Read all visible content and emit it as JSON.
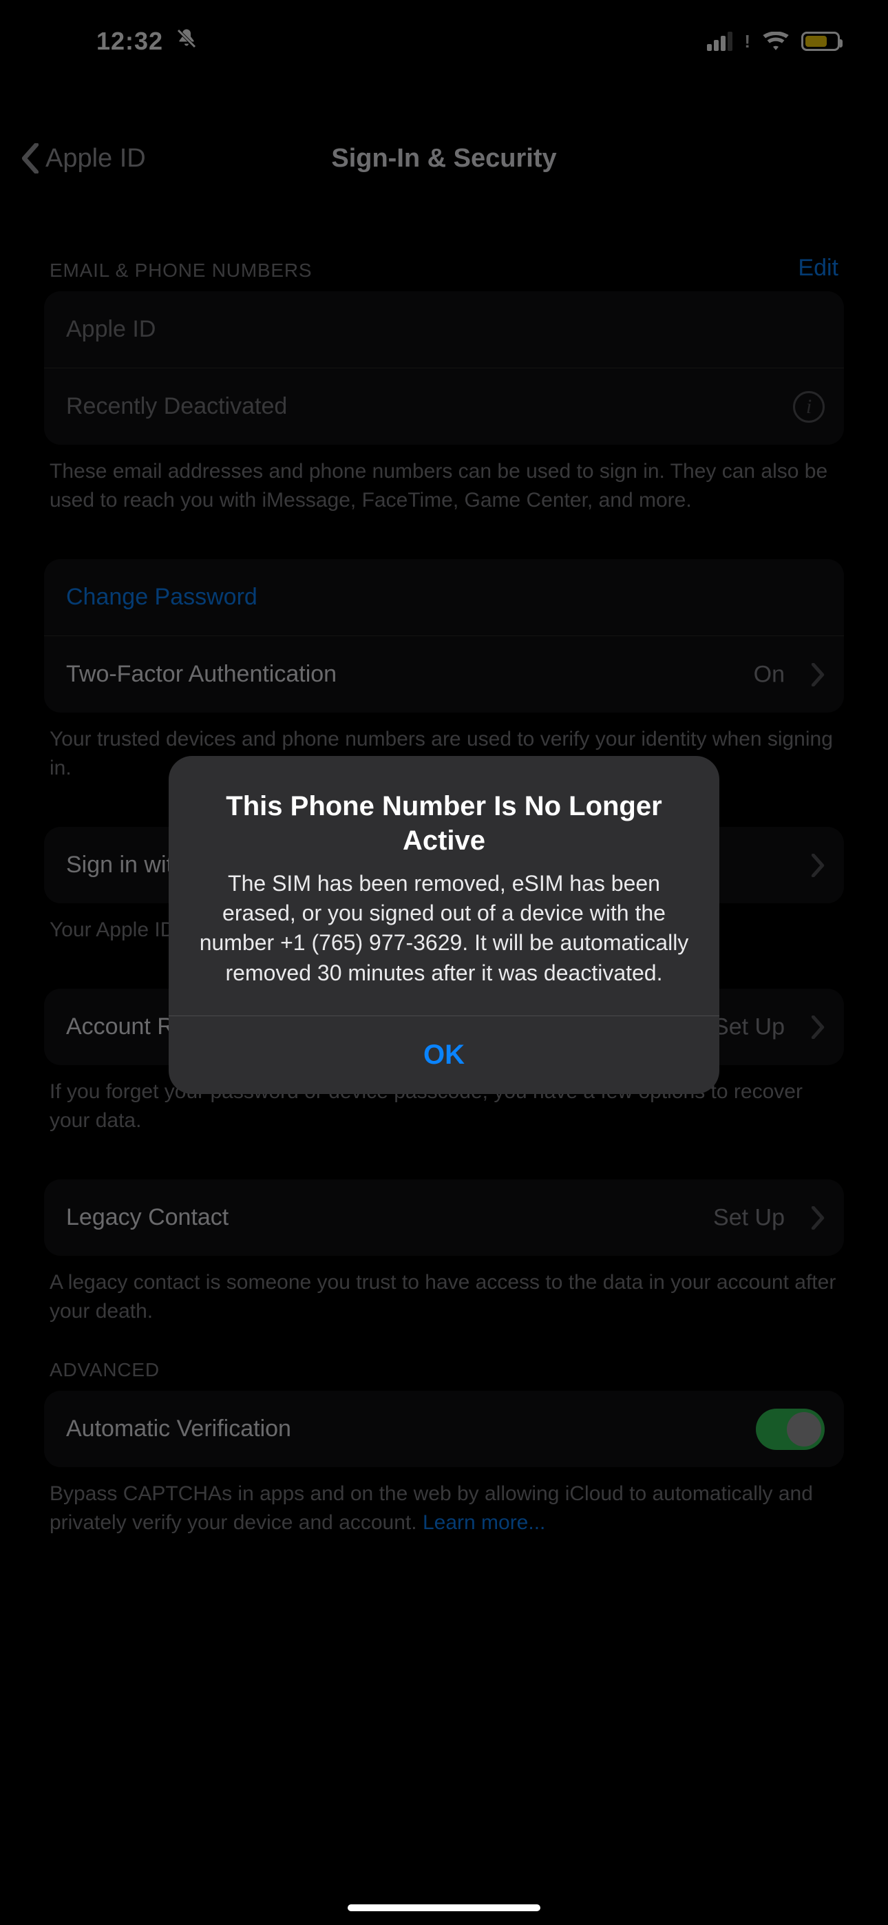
{
  "statusbar": {
    "time": "12:32",
    "silentIcon": "bell-slash"
  },
  "nav": {
    "back": "Apple ID",
    "title": "Sign-In & Security"
  },
  "section1": {
    "header": "EMAIL & PHONE NUMBERS",
    "edit": "Edit",
    "rows": {
      "appleId": "Apple ID",
      "deactivated": "Recently Deactivated"
    },
    "footer": "These email addresses and phone numbers can be used to sign in. They can also be used to reach you with iMessage, FaceTime, Game Center, and more."
  },
  "section2": {
    "changePassword": "Change Password",
    "twoFactor": {
      "label": "Two-Factor Authentication",
      "value": "On"
    },
    "footer": "Your trusted devices and phone numbers are used to verify your identity when signing in."
  },
  "section3": {
    "signIn": {
      "label": "Sign in with Apple"
    },
    "footer": "Your Apple ID can be used to sign in to apps and websites."
  },
  "section4": {
    "recovery": {
      "label": "Account Recovery",
      "value": "Set Up"
    },
    "footer": "If you forget your password or device passcode, you have a few options to recover your data."
  },
  "section5": {
    "legacy": {
      "label": "Legacy Contact",
      "value": "Set Up"
    },
    "footer": "A legacy contact is someone you trust to have access to the data in your account after your death."
  },
  "section6": {
    "header": "ADVANCED",
    "auto": {
      "label": "Automatic Verification"
    },
    "footer": "Bypass CAPTCHAs in apps and on the web by allowing iCloud to automatically and privately verify your device and account.",
    "learnMore": "Learn more..."
  },
  "alert": {
    "title": "This Phone Number Is No Longer Active",
    "message": "The SIM has been removed, eSIM has been erased, or you signed out of a device with the number +1 (765) 977-3629. It will be automatically removed 30 minutes after it was deactivated.",
    "ok": "OK"
  }
}
